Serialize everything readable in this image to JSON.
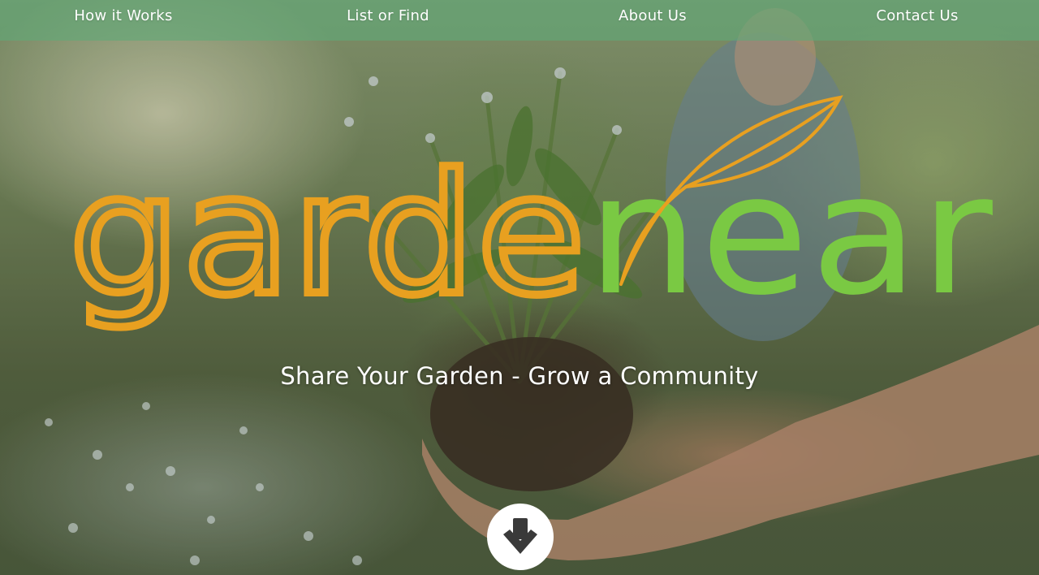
{
  "nav": {
    "items": [
      {
        "label": "How it Works"
      },
      {
        "label": "List or Find"
      },
      {
        "label": "About Us"
      },
      {
        "label": "Contact Us"
      }
    ]
  },
  "logo": {
    "part1": "garde",
    "part2": "near",
    "part1_color": "#e8a020",
    "part2_color": "#7ac943"
  },
  "hero": {
    "tagline": "Share Your Garden - Grow a Community"
  },
  "icons": {
    "scroll": "arrow-down-circle-icon",
    "logo_leaf": "leaf-icon"
  },
  "colors": {
    "navbar": "#60aa78",
    "accent_orange": "#e8a020",
    "accent_green": "#7ac943",
    "text": "#ffffff",
    "scroll_arrow": "#3a3a3a"
  }
}
